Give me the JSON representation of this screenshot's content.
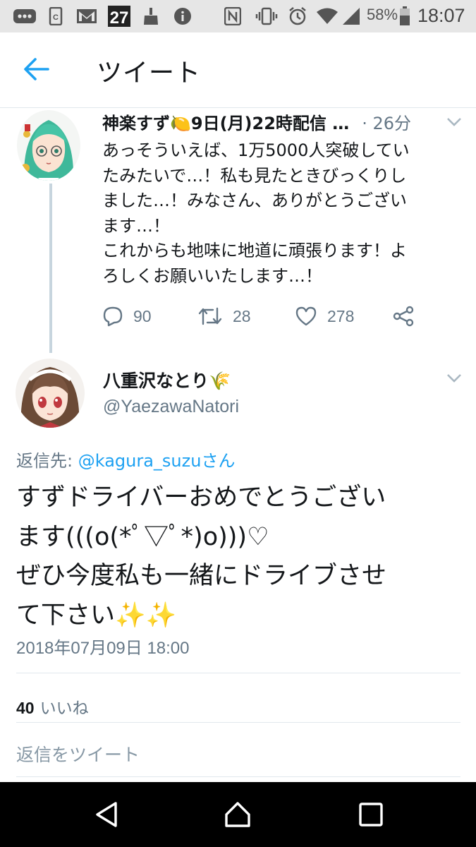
{
  "status_bar": {
    "icons": [
      "more-icon",
      "document-icon",
      "gmail-icon",
      "calendar-27-icon",
      "cleaner-icon",
      "info-icon",
      "nfc-icon",
      "vibrate-icon",
      "alarm-icon",
      "wifi-icon",
      "signal-icon",
      "battery-icon"
    ],
    "calendar_day": "27",
    "battery": "58%",
    "time": "18:07"
  },
  "header": {
    "title": "ツイート"
  },
  "parent_tweet": {
    "name": "神楽すず🍋9日(月)22時配信 …",
    "time_ago": "· 26分",
    "lines": [
      "あっそういえば、1万5000人突破してい",
      "たみたいで…！私も見たときびっくりし",
      "ました…！みなさん、ありがとうござい",
      "ます…！",
      "これからも地味に地道に頑張ります！よ",
      "ろしくお願いいたします…！"
    ],
    "replies": "90",
    "retweets": "28",
    "likes": "278"
  },
  "focused_tweet": {
    "name": "八重沢なとり🌾",
    "handle": "@YaezawaNatori",
    "reply_label": "返信先: ",
    "reply_mention": "@kagura_suzuさん",
    "lines": [
      "すずドライバーおめでとうござい",
      "ます(((o(*ﾟ▽ﾟ*)o)))♡",
      "ぜひ今度私も一緒にドライブさせ",
      "て下さい✨✨"
    ],
    "timestamp": "2018年07月09日 18:00",
    "like_count": "40",
    "like_label": "いいね"
  },
  "reply_box": {
    "placeholder": "返信をツイート"
  },
  "colors": {
    "accent": "#1da1f2",
    "secondary_text": "#657786",
    "divider": "#e1e8ed",
    "thread_line": "#c7d5de"
  }
}
